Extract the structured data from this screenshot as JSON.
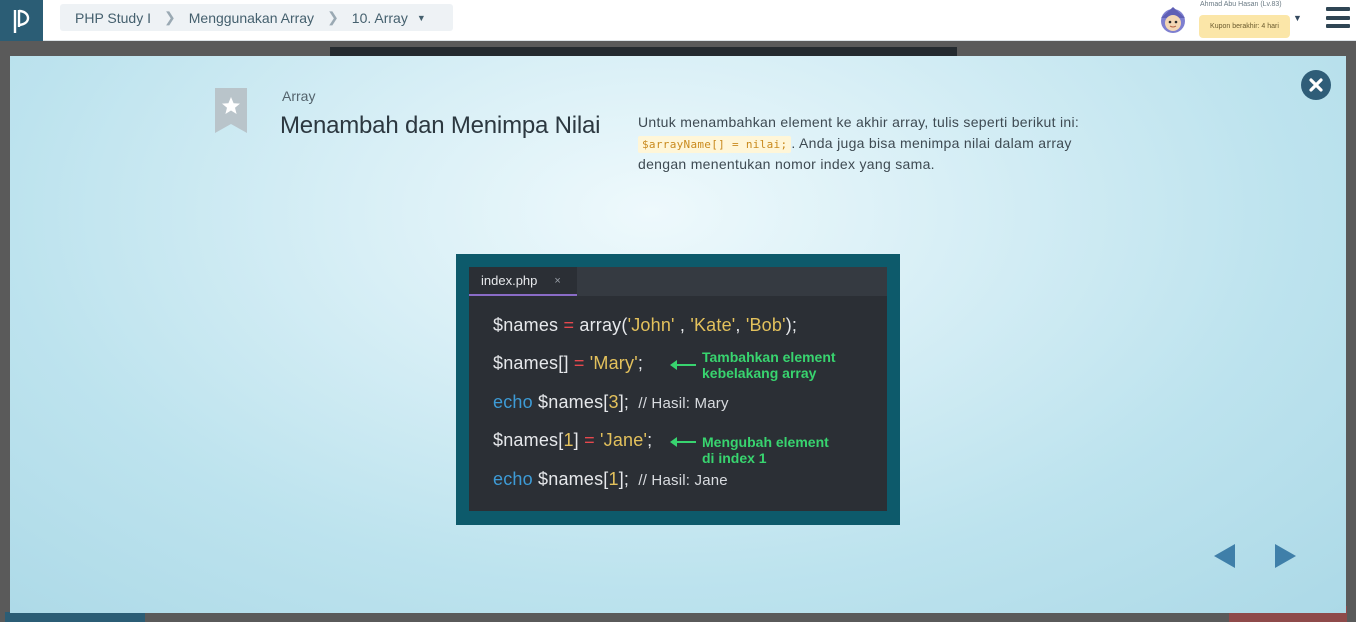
{
  "header": {
    "logo_icon": "progate-logo-icon",
    "breadcrumb": [
      {
        "label": "PHP Study I"
      },
      {
        "label": "Menggunakan Array"
      },
      {
        "label": "10. Array"
      }
    ],
    "user": {
      "name": "Ahmad Abu Hasan (Lv.83)",
      "coupon": "Kupon berakhir: 4 hari"
    }
  },
  "slide": {
    "kicker": "Array",
    "title": "Menambah dan Menimpa Nilai",
    "description_before": "Untuk menambahkan element ke akhir array, tulis seperti berikut ini: ",
    "description_code": "$arrayName[] = nilai;",
    "description_after": ". Anda juga bisa menimpa nilai dalam array dengan menentukan nomor index yang sama."
  },
  "code_image": {
    "tab_name": "index.php",
    "tab_close": "×",
    "lines": [
      {
        "var": "$names",
        "op": "=",
        "call": "array(",
        "s1": "'John'",
        "sep1": " , ",
        "s2": "'Kate'",
        "sep2": ", ",
        "s3": "'Bob'",
        "end": ");"
      },
      {
        "var": "$names[]",
        "op": "=",
        "str": "'Mary'",
        "end": ";"
      },
      {
        "kw": "echo",
        "var": "$names[",
        "num": "3",
        "end": "];",
        "comment": "// Hasil: Mary"
      },
      {
        "var": "$names[",
        "num": "1",
        "close": "]",
        "op": "=",
        "str": "'Jane'",
        "end": ";"
      },
      {
        "kw": "echo",
        "var": "$names[",
        "num": "1",
        "end": "];",
        "comment": "// Hasil: Jane"
      }
    ],
    "annotations": [
      {
        "line1": "Tambahkan element",
        "line2": "kebelakang array"
      },
      {
        "line1": "Mengubah element",
        "line2": "di index 1"
      }
    ]
  },
  "colors": {
    "accent": "#2f5d78",
    "nav_arrow": "#3f7fa9",
    "annotation": "#38d46f"
  }
}
